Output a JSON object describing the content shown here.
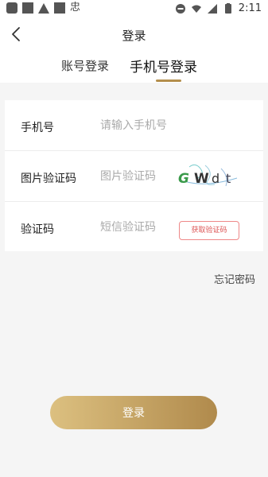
{
  "status_bar": {
    "time": "2:11",
    "left_glyph": "忠"
  },
  "header": {
    "title": "登录",
    "tabs": [
      {
        "label": "账号登录",
        "active": false
      },
      {
        "label": "手机号登录",
        "active": true
      }
    ]
  },
  "form": {
    "phone": {
      "label": "手机号",
      "placeholder": "请输入手机号"
    },
    "image_captcha": {
      "label": "图片验证码",
      "placeholder": "图片验证码",
      "captcha_text": "G W d t"
    },
    "sms_code": {
      "label": "验证码",
      "placeholder": "短信验证码",
      "button_label": "获取验证码"
    }
  },
  "forgot_password": "忘记密码",
  "login_button": "登录",
  "colors": {
    "accent": "#b38e4c",
    "button_gradient_start": "#dcc080",
    "button_gradient_end": "#b08a4c",
    "sms_button": "#dd5555",
    "background": "#f5f5f5"
  }
}
